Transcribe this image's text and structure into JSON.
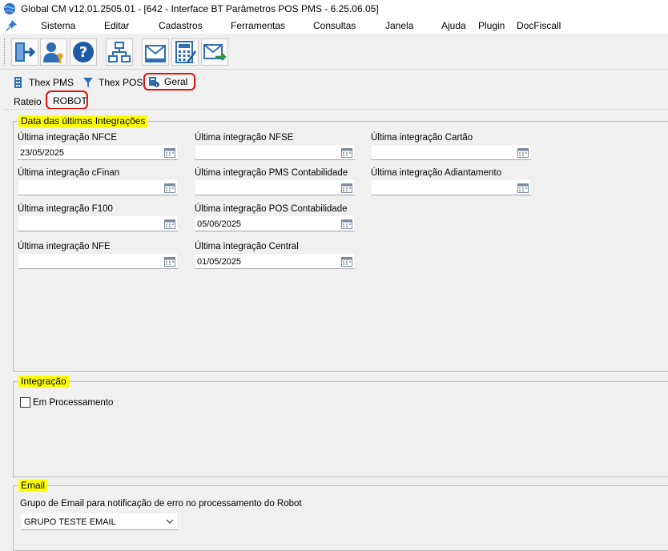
{
  "window": {
    "title": "Global CM v12.01.2505.01 - [642 - Interface BT Parâmetros POS PMS - 6.25.06.05]"
  },
  "menu": [
    "Sistema",
    "Editar",
    "Cadastros",
    "Ferramentas",
    "Consultas",
    "Janela",
    "Ajuda",
    "Plugin",
    "DocFiscall"
  ],
  "toolbar_icons": [
    "exit-icon",
    "user-key-icon",
    "help-icon",
    "hierarchy-icon",
    "mail-icon",
    "calculator-icon",
    "mail-send-icon"
  ],
  "tabs": {
    "thex_pms": "Thex PMS",
    "thex_pos": "Thex POS",
    "geral": "Geral"
  },
  "subtabs": {
    "rateio": "Rateio",
    "robot": "ROBOT"
  },
  "group_dates": {
    "legend": "Data das últimas Integrações",
    "fields": {
      "nfce": {
        "label": "Última integração NFCE",
        "value": "23/05/2025"
      },
      "nfse": {
        "label": "Última integração NFSE",
        "value": ""
      },
      "cartao": {
        "label": "Última integração Cartão",
        "value": ""
      },
      "cfinan": {
        "label": "Última integração cFinan",
        "value": ""
      },
      "pms_contab": {
        "label": "Última integração PMS Contabilidade",
        "value": ""
      },
      "adiantamento": {
        "label": "Última integração Adiantamento",
        "value": ""
      },
      "f100": {
        "label": "Última integração F100",
        "value": ""
      },
      "pos_contab": {
        "label": "Última integração POS Contabilidade",
        "value": "05/06/2025"
      },
      "nfe": {
        "label": "Última integração NFE",
        "value": ""
      },
      "central": {
        "label": "Última integração Central",
        "value": "01/05/2025"
      }
    }
  },
  "group_integracao": {
    "legend": "Integração",
    "checkbox_label": "Em Processamento",
    "checked": false
  },
  "group_email": {
    "legend": "Email",
    "label": "Grupo de Email para notificação de erro no processamento do Robot",
    "selected": "GRUPO TESTE EMAIL"
  },
  "colors": {
    "highlight": "#ffff00",
    "annotation": "#e01010"
  }
}
